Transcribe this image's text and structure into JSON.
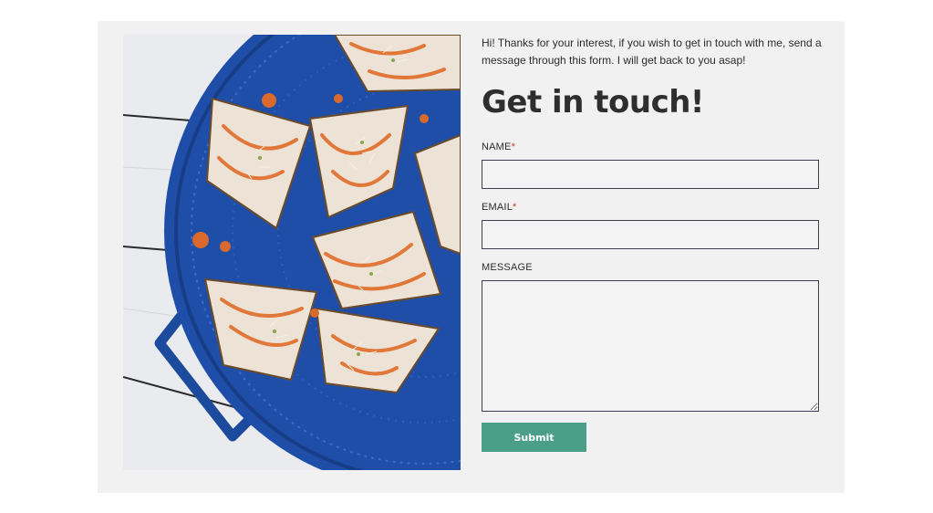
{
  "form": {
    "intro": "Hi! Thanks for your interest, if you wish to get in touch with me, send a message through this form. I will get back to you asap!",
    "heading": "Get in touch!",
    "required_marker": "*",
    "fields": {
      "name": {
        "label": "NAME",
        "value": "",
        "placeholder": ""
      },
      "email": {
        "label": "EMAIL",
        "value": "",
        "placeholder": ""
      },
      "message": {
        "label": "MESSAGE",
        "value": "",
        "placeholder": ""
      }
    },
    "submit_label": "Submit"
  },
  "colors": {
    "card_background": "#f1f1f1",
    "submit_background": "#4a9e8a",
    "required_marker": "#c0392b",
    "plate_blue": "#1f4ea8"
  }
}
